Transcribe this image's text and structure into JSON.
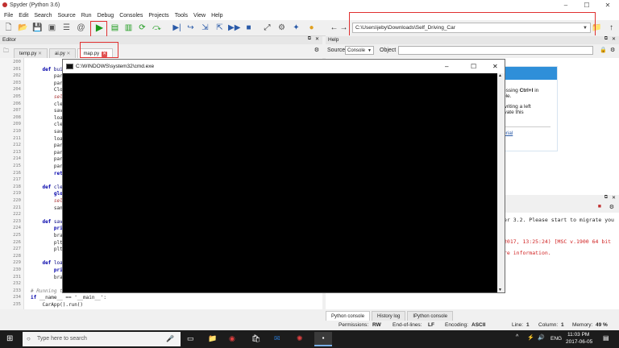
{
  "window": {
    "title": "Spyder (Python 3.6)"
  },
  "menu": [
    "File",
    "Edit",
    "Search",
    "Source",
    "Run",
    "Debug",
    "Consoles",
    "Projects",
    "Tools",
    "View",
    "Help"
  ],
  "toolbar": {
    "path": "C:\\Users\\jeby\\Downloads\\Self_Driving_Car"
  },
  "editor": {
    "title": "Editor",
    "tabs": [
      "temp.py",
      "ai.py",
      "map.py"
    ],
    "line_numbers": [
      "200",
      "201",
      "202",
      "203",
      "204",
      "205",
      "206",
      "207",
      "208",
      "209",
      "210",
      "211",
      "212",
      "213",
      "214",
      "215",
      "216",
      "217",
      "218",
      "219",
      "220",
      "221",
      "222",
      "223",
      "224",
      "225",
      "226",
      "227",
      "228",
      "229",
      "230",
      "231",
      "232",
      "233",
      "234",
      "235"
    ],
    "lines": [
      {
        "n": "201",
        "indent": "    ",
        "kw": "def ",
        "fn": "build",
        "rest": ""
      },
      {
        "n": "202",
        "indent": "        ",
        "text": "paren"
      },
      {
        "n": "203",
        "indent": "        ",
        "text": "paren"
      },
      {
        "n": "204",
        "indent": "        ",
        "text": "Clock"
      },
      {
        "n": "205",
        "indent": "        ",
        "self": "self."
      },
      {
        "n": "206",
        "indent": "        ",
        "text": "clear"
      },
      {
        "n": "207",
        "indent": "        ",
        "text": "saveb"
      },
      {
        "n": "208",
        "indent": "        ",
        "text": "loadb"
      },
      {
        "n": "209",
        "indent": "        ",
        "text": "clear"
      },
      {
        "n": "210",
        "indent": "        ",
        "text": "saveb"
      },
      {
        "n": "211",
        "indent": "        ",
        "text": "loadb"
      },
      {
        "n": "212",
        "indent": "        ",
        "text": "paren"
      },
      {
        "n": "213",
        "indent": "        ",
        "text": "paren"
      },
      {
        "n": "214",
        "indent": "        ",
        "text": "paren"
      },
      {
        "n": "215",
        "indent": "        ",
        "text": "paren"
      },
      {
        "n": "216",
        "indent": "        ",
        "kw2": "retur"
      },
      {
        "n": "218",
        "indent": "    ",
        "kw": "def ",
        "fn": "clear"
      },
      {
        "n": "219",
        "indent": "        ",
        "kw2": "globa"
      },
      {
        "n": "220",
        "indent": "        ",
        "self": "self.p"
      },
      {
        "n": "221",
        "indent": "        ",
        "text": "sand "
      },
      {
        "n": "223",
        "indent": "    ",
        "kw": "def ",
        "fn": "save("
      },
      {
        "n": "224",
        "indent": "        ",
        "kw2": "print"
      },
      {
        "n": "225",
        "indent": "        ",
        "text": "brain"
      },
      {
        "n": "226",
        "indent": "        ",
        "text": "plt.p"
      },
      {
        "n": "227",
        "indent": "        ",
        "text": "plt.s"
      },
      {
        "n": "229",
        "indent": "    ",
        "kw": "def ",
        "fn": "load("
      },
      {
        "n": "230",
        "indent": "        ",
        "kw2": "print"
      },
      {
        "n": "231",
        "indent": "        ",
        "text": "brain"
      },
      {
        "n": "233",
        "indent": "",
        "cmt": "# Running the"
      },
      {
        "n": "234",
        "indent": "",
        "kw": "if ",
        "text": "__name__ == '__main__':"
      },
      {
        "n": "235",
        "indent": "    ",
        "text": "CarApp().run()"
      }
    ]
  },
  "help": {
    "title": "Help",
    "source_label": "Source",
    "source_value": "Console",
    "object_label": "Object",
    "text1_pre": "essing ",
    "text1_bold": "Ctrl+I",
    "text1_post": " in",
    "text2": "ole.",
    "text3": "writing a left",
    "text4": "ivate this",
    "link": "orial"
  },
  "console": {
    "line1": "er 3.2. Please start to migrate you",
    "line2": "2017, 13:25:24) [MSC v.1900 64 bit",
    "line3": "re information.",
    "tabs": [
      "Python console",
      "History log",
      "IPython console"
    ]
  },
  "cmd": {
    "title": "C:\\WINDOWS\\system32\\cmd.exe"
  },
  "status": {
    "permissions_label": "Permissions:",
    "permissions": "RW",
    "eol_label": "End-of-lines:",
    "eol": "LF",
    "encoding_label": "Encoding:",
    "encoding": "ASCII",
    "line_label": "Line:",
    "line": "1",
    "column_label": "Column:",
    "column": "1",
    "memory_label": "Memory:",
    "memory": "49 %"
  },
  "taskbar": {
    "search_placeholder": "Type here to search",
    "lang": "ENG",
    "time": "11:03 PM",
    "date": "2017-06-05"
  },
  "colors": {
    "highlight_box": "#e03030",
    "run_green": "#1a9a1a"
  }
}
